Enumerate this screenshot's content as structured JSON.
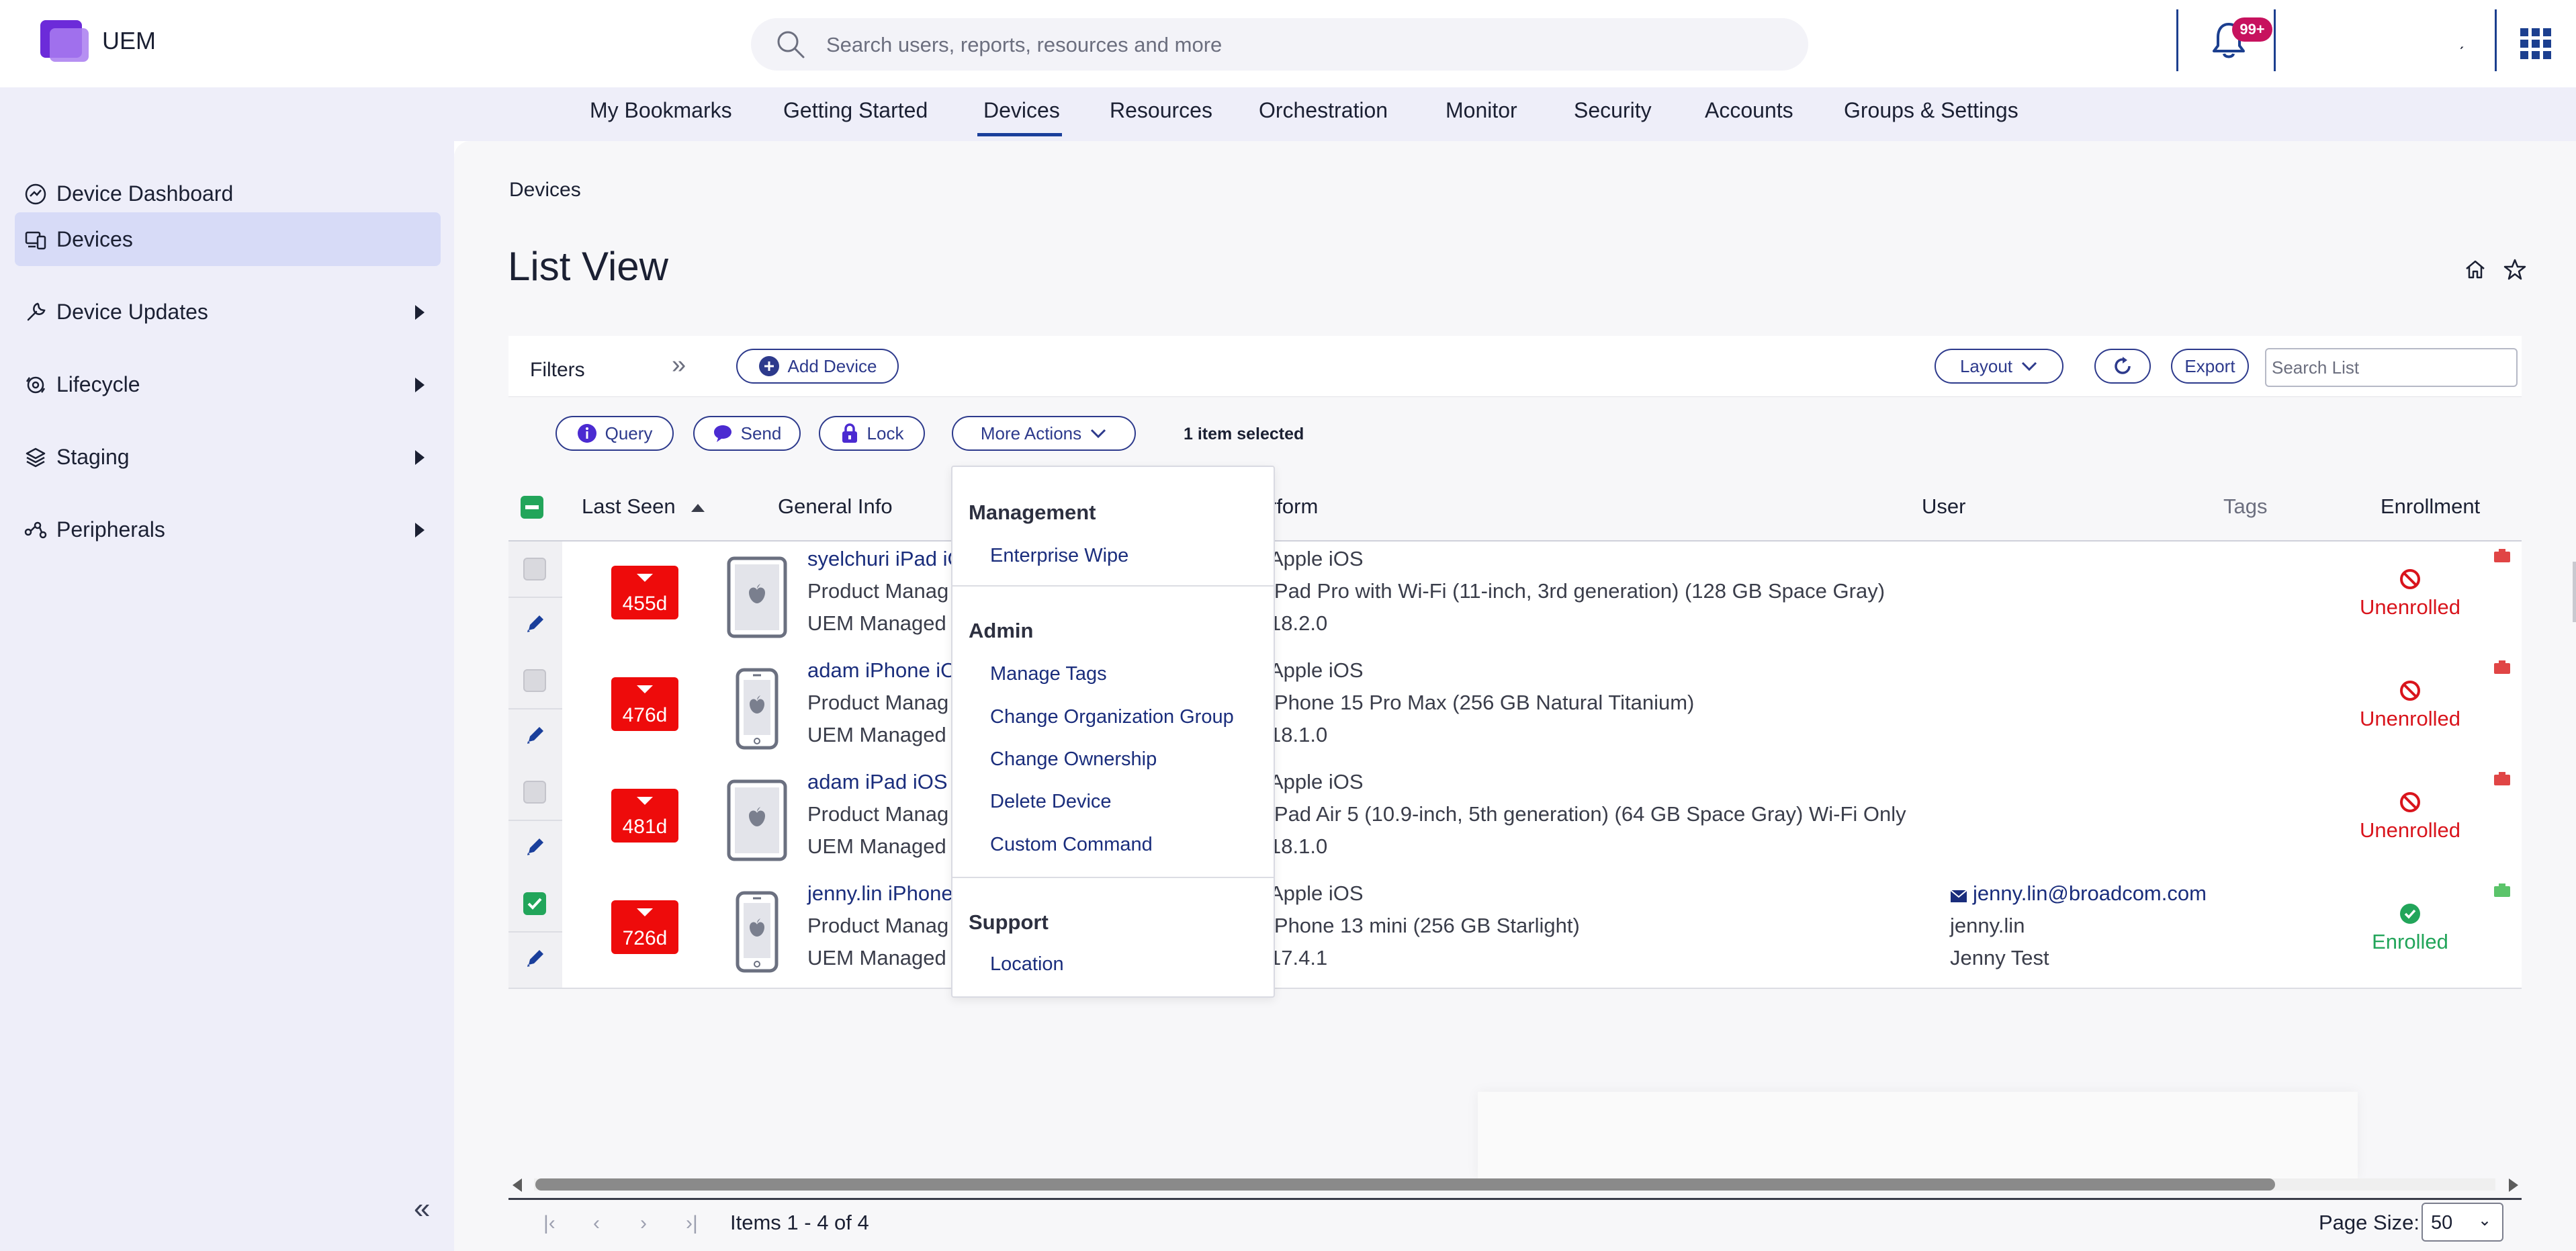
{
  "app": {
    "title": "UEM"
  },
  "search": {
    "placeholder": "Search users, reports, resources and more"
  },
  "notifications": {
    "badge": "99+"
  },
  "header_mark": "ˏ",
  "nav": {
    "items": [
      {
        "label": "My Bookmarks",
        "active": false
      },
      {
        "label": "Getting Started",
        "active": false
      },
      {
        "label": "Devices",
        "active": true
      },
      {
        "label": "Resources",
        "active": false
      },
      {
        "label": "Orchestration",
        "active": false
      },
      {
        "label": "Monitor",
        "active": false
      },
      {
        "label": "Security",
        "active": false
      },
      {
        "label": "Accounts",
        "active": false
      },
      {
        "label": "Groups & Settings",
        "active": false
      }
    ]
  },
  "sidebar": {
    "items": [
      {
        "label": "Device Dashboard",
        "icon": "dashboard-icon",
        "active": false,
        "expandable": false
      },
      {
        "label": "Devices",
        "icon": "devices-icon",
        "active": true,
        "expandable": false
      },
      {
        "label": "Device Updates",
        "icon": "wrench-icon",
        "active": false,
        "expandable": true
      },
      {
        "label": "Lifecycle",
        "icon": "lifecycle-icon",
        "active": false,
        "expandable": true
      },
      {
        "label": "Staging",
        "icon": "layers-icon",
        "active": false,
        "expandable": true
      },
      {
        "label": "Peripherals",
        "icon": "peripherals-icon",
        "active": false,
        "expandable": true
      }
    ],
    "collapse_glyph": "«"
  },
  "breadcrumb": "Devices",
  "page_title": "List View",
  "toolbar": {
    "filters_label": "Filters",
    "filters_toggle": "»",
    "add_device": "Add Device",
    "layout": "Layout",
    "export": "Export",
    "search_placeholder": "Search List"
  },
  "actions": {
    "query": "Query",
    "send": "Send",
    "lock": "Lock",
    "more_actions": "More Actions",
    "selected_count": "1 item selected"
  },
  "table": {
    "headers": {
      "last_seen": "Last Seen",
      "general_info": "General Info",
      "platform": "rform",
      "user": "User",
      "tags": "Tags",
      "enrollment": "Enrollment"
    },
    "rows": [
      {
        "selected": false,
        "last_seen": "455d",
        "device_type": "ipad",
        "name": "syelchuri iPad iO",
        "group": "Product Manag",
        "managed": "UEM Managed",
        "platform": "Apple iOS",
        "model": "iPad Pro with Wi-Fi (11-inch, 3rd generation) (128 GB Space Gray)",
        "os": "18.2.0",
        "user_email": "",
        "user_name": "",
        "user_full": "",
        "enrollment": "Unenrolled"
      },
      {
        "selected": false,
        "last_seen": "476d",
        "device_type": "iphone",
        "name": "adam iPhone iO",
        "group": "Product Manag",
        "managed": "UEM Managed",
        "platform": "Apple iOS",
        "model": "iPhone 15 Pro Max (256 GB Natural Titanium)",
        "os": "18.1.0",
        "user_email": "",
        "user_name": "",
        "user_full": "",
        "enrollment": "Unenrolled"
      },
      {
        "selected": false,
        "last_seen": "481d",
        "device_type": "ipad",
        "name": "adam iPad iOS",
        "group": "Product Manag",
        "managed": "UEM Managed",
        "platform": "Apple iOS",
        "model": "iPad Air 5 (10.9-inch, 5th generation) (64 GB Space Gray) Wi-Fi Only",
        "os": "18.1.0",
        "user_email": "",
        "user_name": "",
        "user_full": "",
        "enrollment": "Unenrolled"
      },
      {
        "selected": true,
        "last_seen": "726d",
        "device_type": "iphone",
        "name": "jenny.lin iPhone",
        "group": "Product Manag",
        "managed": "UEM Managed",
        "platform": "Apple iOS",
        "model": "iPhone 13 mini (256 GB Starlight)",
        "os": "17.4.1",
        "user_email": "jenny.lin@broadcom.com",
        "user_name": "jenny.lin",
        "user_full": "Jenny Test",
        "enrollment": "Enrolled"
      }
    ]
  },
  "more_actions_menu": {
    "sections": [
      {
        "title": "Management",
        "items": [
          "Enterprise Wipe"
        ]
      },
      {
        "title": "Admin",
        "items": [
          "Manage Tags",
          "Change Organization Group",
          "Change Ownership",
          "Delete Device",
          "Custom Command"
        ]
      },
      {
        "title": "Support",
        "items": [
          "Location"
        ]
      }
    ]
  },
  "pager": {
    "first": "|‹",
    "prev": "‹",
    "next": "›",
    "last": "›|",
    "items_text": "Items 1 - 4 of 4",
    "page_size_label": "Page Size:",
    "page_size_value": "50",
    "page_size_caret": "⌄"
  },
  "colors": {
    "accent": "#1a3f9b",
    "last_seen_alert": "#ee0b0b",
    "unenrolled": "#d9141c",
    "enrolled": "#22a55a",
    "badge": "#c7125e"
  }
}
